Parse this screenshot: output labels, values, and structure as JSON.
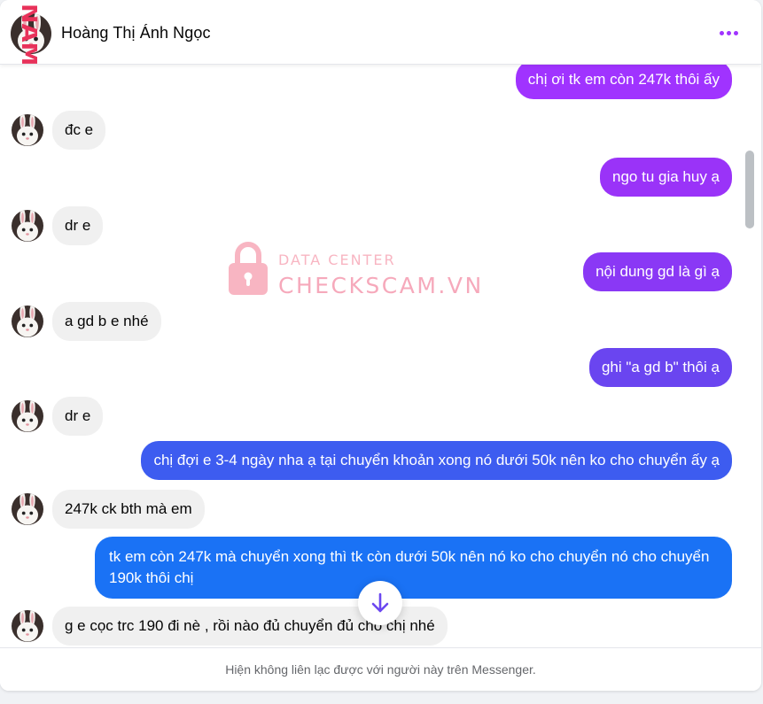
{
  "header": {
    "name": "Hoàng Thị Ánh Ngọc",
    "more_icon": "more-dots-icon"
  },
  "side_mark": "NAM",
  "messages": [
    {
      "side": "outgoing",
      "text": "chị ơi tk em còn 247k thôi ấy",
      "color": "#a033ff"
    },
    {
      "side": "incoming",
      "text": "đc e"
    },
    {
      "side": "outgoing",
      "text": "ngo tu gia huy ạ",
      "color": "#9a33f8"
    },
    {
      "side": "incoming",
      "text": "dr e"
    },
    {
      "side": "outgoing",
      "text": "nội dung gd là gì ạ",
      "color": "#8a38f5"
    },
    {
      "side": "incoming",
      "text": "a gd b e nhé"
    },
    {
      "side": "outgoing",
      "text": "ghi \"a gd b\" thôi ạ",
      "color": "#6a45f0"
    },
    {
      "side": "incoming",
      "text": "dr e"
    },
    {
      "side": "outgoing",
      "text": "chị đợi e 3-4 ngày nha ạ tại chuyển khoản xong nó dưới 50k nên ko cho chuyển ấy ạ",
      "color": "#3d5cf0"
    },
    {
      "side": "incoming",
      "text": "247k ck bth mà em"
    },
    {
      "side": "outgoing",
      "text": "tk em còn 247k mà chuyển xong thì tk còn dưới 50k nên nó ko cho chuyển nó cho chuyển 190k thôi chị",
      "color": "#1a72f5"
    },
    {
      "side": "incoming",
      "text": "g e cọc trc 190 đi nè , rồi nào đủ chuyển đủ cho chị nhé"
    }
  ],
  "scroll_down_icon": "arrow-down-icon",
  "footer": {
    "text": "Hiện không liên lạc được với người này trên Messenger."
  },
  "watermark": {
    "line1": "DATA CENTER",
    "line2": "CHECKSCAM.VN"
  }
}
